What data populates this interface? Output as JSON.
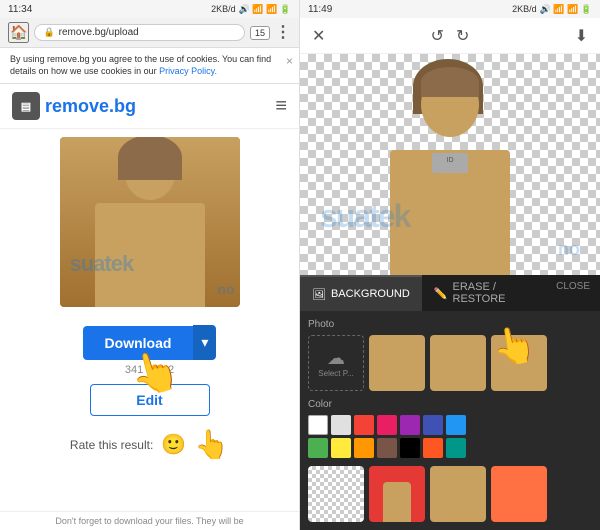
{
  "left": {
    "statusBar": {
      "time": "11:34",
      "dataInfo": "2KB/d",
      "icons": "🔊📶📶📶🔋",
      "rightInfo": "2KB/d ♦ ⏰ 📶 📶 ▾"
    },
    "browserBar": {
      "url": "remove.bg/upload",
      "tabCount": "15"
    },
    "cookieBanner": {
      "text": "By using remove.bg you agree to the use of cookies. You can find details on how we use cookies in our",
      "linkText": "Privacy Policy.",
      "closeLabel": "×"
    },
    "logo": {
      "text": "remove",
      "dotbg": ".bg",
      "iconLabel": "▤"
    },
    "imageSize": "341 × 512",
    "downloadBtn": "Download",
    "downloadArrow": "▾",
    "editBtn": "Edit",
    "rateLabel": "Rate this result:",
    "footerText": "Don't forget to download your files. They will be",
    "watermark1": "suatek",
    "watermark2": "no"
  },
  "right": {
    "statusBar": {
      "time": "11:49",
      "rightInfo": "2KB/d ♦ ⏰ 📶 📶 ▾"
    },
    "toolbar": {
      "closeIcon": "✕",
      "undoIcon": "↺",
      "redoIcon": "↻",
      "downloadIcon": "⬇"
    },
    "tabs": {
      "background": "BACKGROUND",
      "eraseRestore": "ERASE / RESTORE",
      "close": "CLOSE"
    },
    "bgSection": {
      "photoLabel": "Photo",
      "uploadLabel": "Select P...",
      "colorLabel": "Color"
    },
    "colors": [
      "#ffffff",
      "#e0e0e0",
      "#f44336",
      "#e91e63",
      "#9c27b0",
      "#3f51b5",
      "#2196f3",
      "#4caf50",
      "#ffeb3b",
      "#ff9800",
      "#795548",
      "#000000",
      "#ff5722",
      "#009688"
    ],
    "watermark1": "suatek",
    "watermark2": "no"
  }
}
